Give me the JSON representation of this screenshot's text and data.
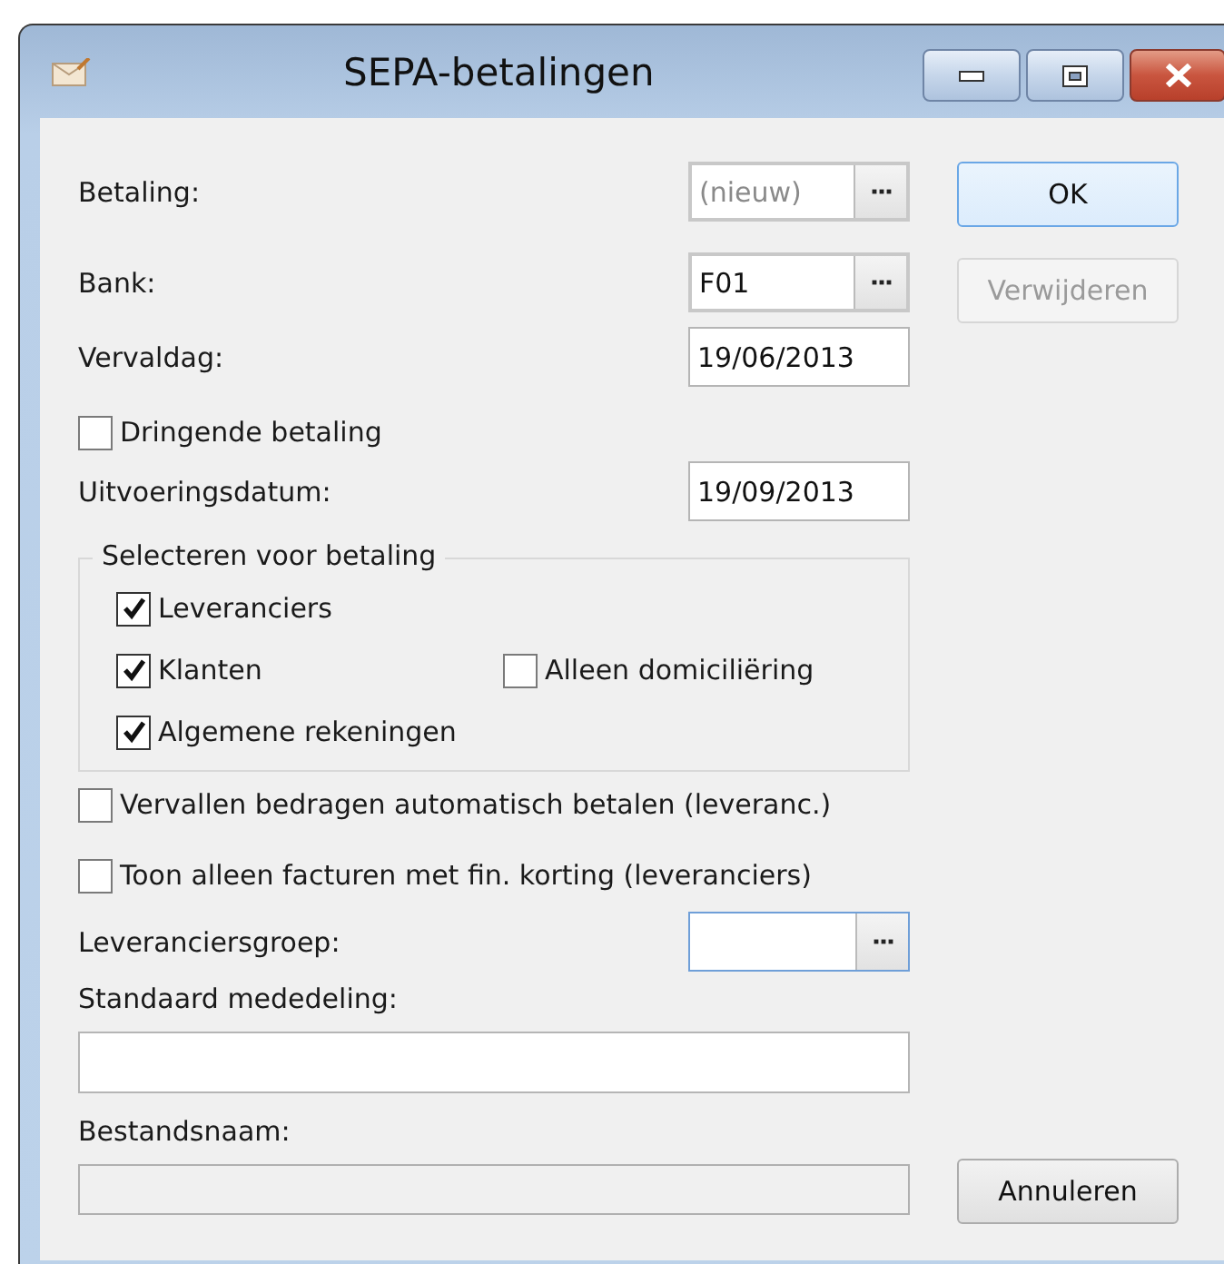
{
  "window": {
    "title": "SEPA-betalingen"
  },
  "rows": [
    {
      "kind": "lookup",
      "label": "Betaling:",
      "placeholder": "(nieuw)",
      "focused": false
    },
    {
      "kind": "lookup",
      "label": "Bank:",
      "value": "F01",
      "focused": false
    },
    {
      "kind": "text",
      "label": "Vervaldag:",
      "value": "19/06/2013"
    },
    {
      "kind": "checkbox",
      "label": "Dringende betaling",
      "checked": false
    },
    {
      "kind": "text",
      "label": "Uitvoeringsdatum:",
      "value": "19/09/2013"
    },
    {
      "kind": "group",
      "title": "Selecteren voor betaling",
      "lines": [
        [
          {
            "label": "Leveranciers",
            "checked": true
          }
        ],
        [
          {
            "label": "Klanten",
            "checked": true
          },
          {
            "label": "Alleen domiciliëring",
            "checked": false
          }
        ],
        [
          {
            "label": "Algemene rekeningen",
            "checked": true
          }
        ]
      ]
    },
    {
      "kind": "checkbox",
      "label": "Vervallen bedragen automatisch betalen (leveranc.)",
      "checked": false
    },
    {
      "kind": "checkbox",
      "label": "Toon alleen facturen met fin. korting (leveranciers)",
      "checked": false
    },
    {
      "kind": "lookup",
      "label": "Leveranciersgroep:",
      "focused": true
    },
    {
      "kind": "wide",
      "label": "Standaard mededeling:",
      "disabled": false
    },
    {
      "kind": "wide",
      "label": "Bestandsnaam:",
      "disabled": true
    }
  ],
  "buttons_top": [
    {
      "label": "OK",
      "default": true,
      "disabled": false
    },
    {
      "label": "Verwijderen",
      "default": false,
      "disabled": true
    }
  ],
  "buttons_bottom": [
    {
      "label": "Annuleren",
      "default": false,
      "disabled": false
    }
  ]
}
